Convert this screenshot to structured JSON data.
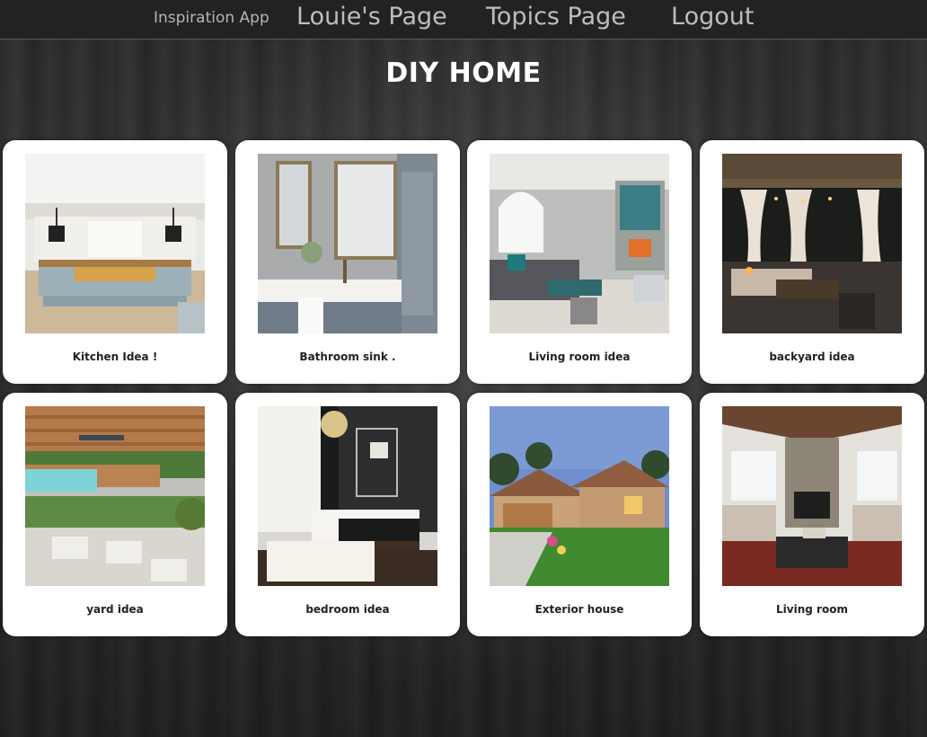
{
  "nav": {
    "brand": "Inspiration App",
    "links": [
      "Louie's Page",
      "Topics Page",
      "Logout"
    ]
  },
  "page": {
    "title": "DIY HOME"
  },
  "cards": [
    {
      "caption": "Kitchen Idea !",
      "image": "kitchen-photo"
    },
    {
      "caption": "Bathroom sink .",
      "image": "bathroom-photo"
    },
    {
      "caption": "Living room idea",
      "image": "living-room-photo"
    },
    {
      "caption": "backyard idea",
      "image": "backyard-photo"
    },
    {
      "caption": "yard idea",
      "image": "yard-photo"
    },
    {
      "caption": "bedroom idea",
      "image": "bedroom-photo"
    },
    {
      "caption": "Exterior house",
      "image": "exterior-house-photo"
    },
    {
      "caption": "Living room",
      "image": "living-room-2-photo"
    }
  ],
  "colors": {
    "navbar": "#222222",
    "nav_text": "#bdbdbd",
    "card_bg": "#ffffff",
    "title": "#ffffff"
  }
}
